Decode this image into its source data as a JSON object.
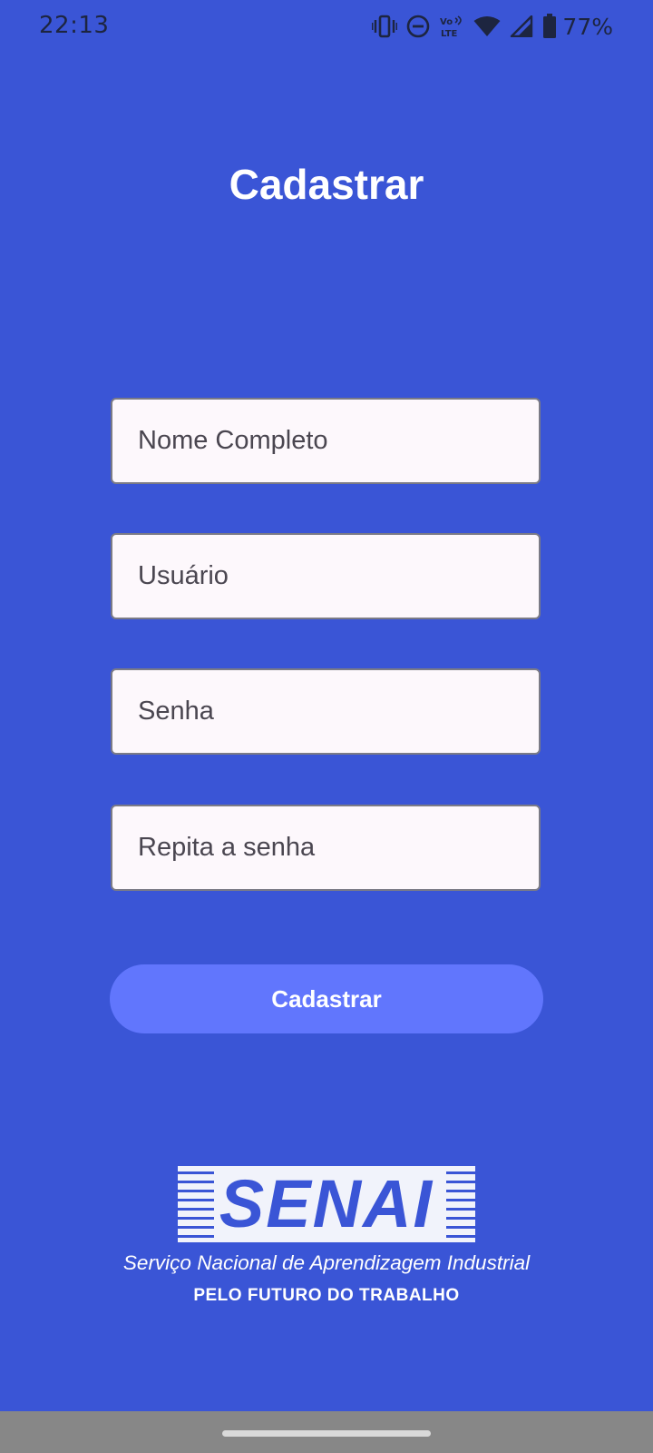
{
  "status_bar": {
    "time": "22:13",
    "battery_percent": "77%",
    "icons": [
      "vibrate-icon",
      "do-not-disturb-icon",
      "volte-icon",
      "wifi-icon",
      "signal-icon",
      "battery-icon"
    ]
  },
  "page": {
    "title": "Cadastrar"
  },
  "form": {
    "full_name": {
      "placeholder": "Nome Completo",
      "value": ""
    },
    "username": {
      "placeholder": "Usuário",
      "value": ""
    },
    "password": {
      "placeholder": "Senha",
      "value": ""
    },
    "repeat_password": {
      "placeholder": "Repita a senha",
      "value": ""
    },
    "submit_label": "Cadastrar"
  },
  "logo": {
    "wordmark": "SENAI",
    "tagline": "Serviço Nacional de Aprendizagem Industrial",
    "slogan": "PELO FUTURO DO TRABALHO"
  },
  "colors": {
    "background": "#3a55d6",
    "button": "#6176fd",
    "field_background": "#fdf8fc",
    "text_light": "#ffffff"
  }
}
